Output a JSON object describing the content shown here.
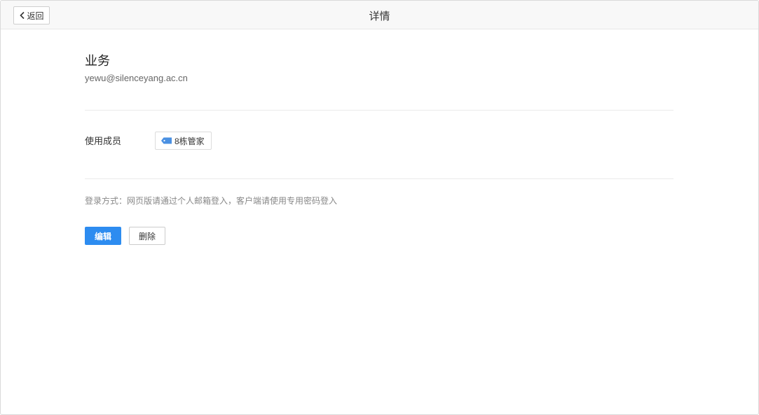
{
  "header": {
    "back_label": "返回",
    "title": "详情"
  },
  "account": {
    "name": "业务",
    "email": "yewu@silenceyang.ac.cn"
  },
  "members": {
    "label": "使用成员",
    "tags": [
      {
        "icon": "tag-icon",
        "label": "8栋管家"
      }
    ]
  },
  "login_note": "登录方式：网页版请通过个人邮箱登入，客户端请使用专用密码登入",
  "actions": {
    "edit_label": "编辑",
    "delete_label": "删除"
  },
  "colors": {
    "primary": "#2d8cf0",
    "tag_icon": "#4a90e2"
  }
}
